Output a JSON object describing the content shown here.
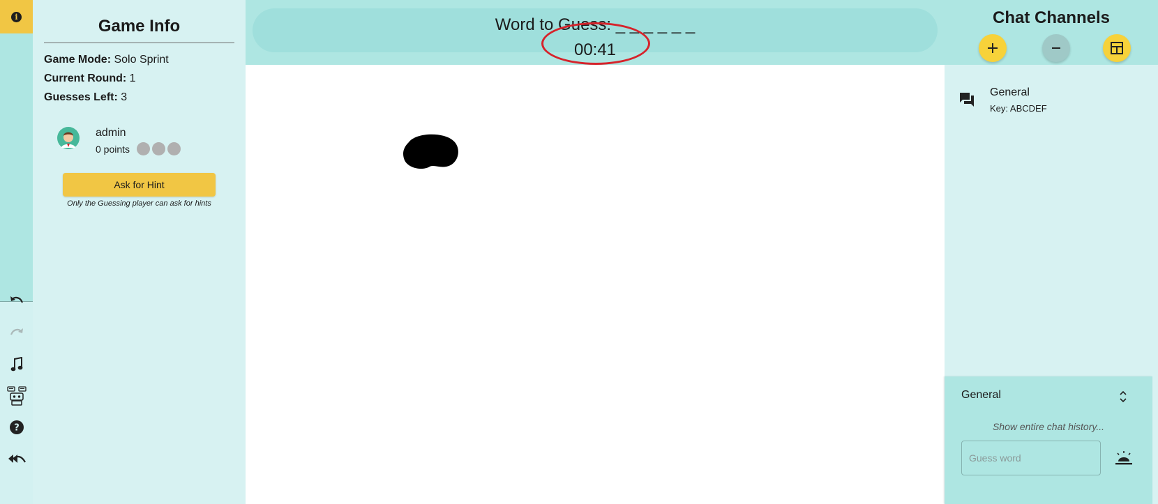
{
  "header": {
    "word_label": "Word to Guess: _ _ _ _ _ _",
    "timer": "00:41"
  },
  "game_info": {
    "title": "Game Info",
    "mode_label": "Game Mode:",
    "mode_value": "Solo Sprint",
    "round_label": "Current Round:",
    "round_value": "1",
    "guesses_label": "Guesses Left:",
    "guesses_value": "3",
    "player": {
      "name": "admin",
      "points": "0 points",
      "badge_count": 3
    },
    "hint_button": "Ask for Hint",
    "hint_note": "Only the Guessing player can ask for hints"
  },
  "tools": [
    "undo-icon",
    "redo-icon",
    "music-note-icon",
    "robot-icon",
    "help-icon",
    "exit-icon"
  ],
  "chat": {
    "title": "Chat Channels",
    "channels": [
      {
        "name": "General",
        "key": "Key: ABCDEF"
      }
    ],
    "active_channel": "General",
    "history_link": "Show entire chat history...",
    "input_placeholder": "Guess word"
  },
  "colors": {
    "accent": "#f1c644",
    "header_bg": "#aee6e2",
    "panel_bg": "#d7f2f2",
    "timer_highlight": "#d6232b"
  }
}
